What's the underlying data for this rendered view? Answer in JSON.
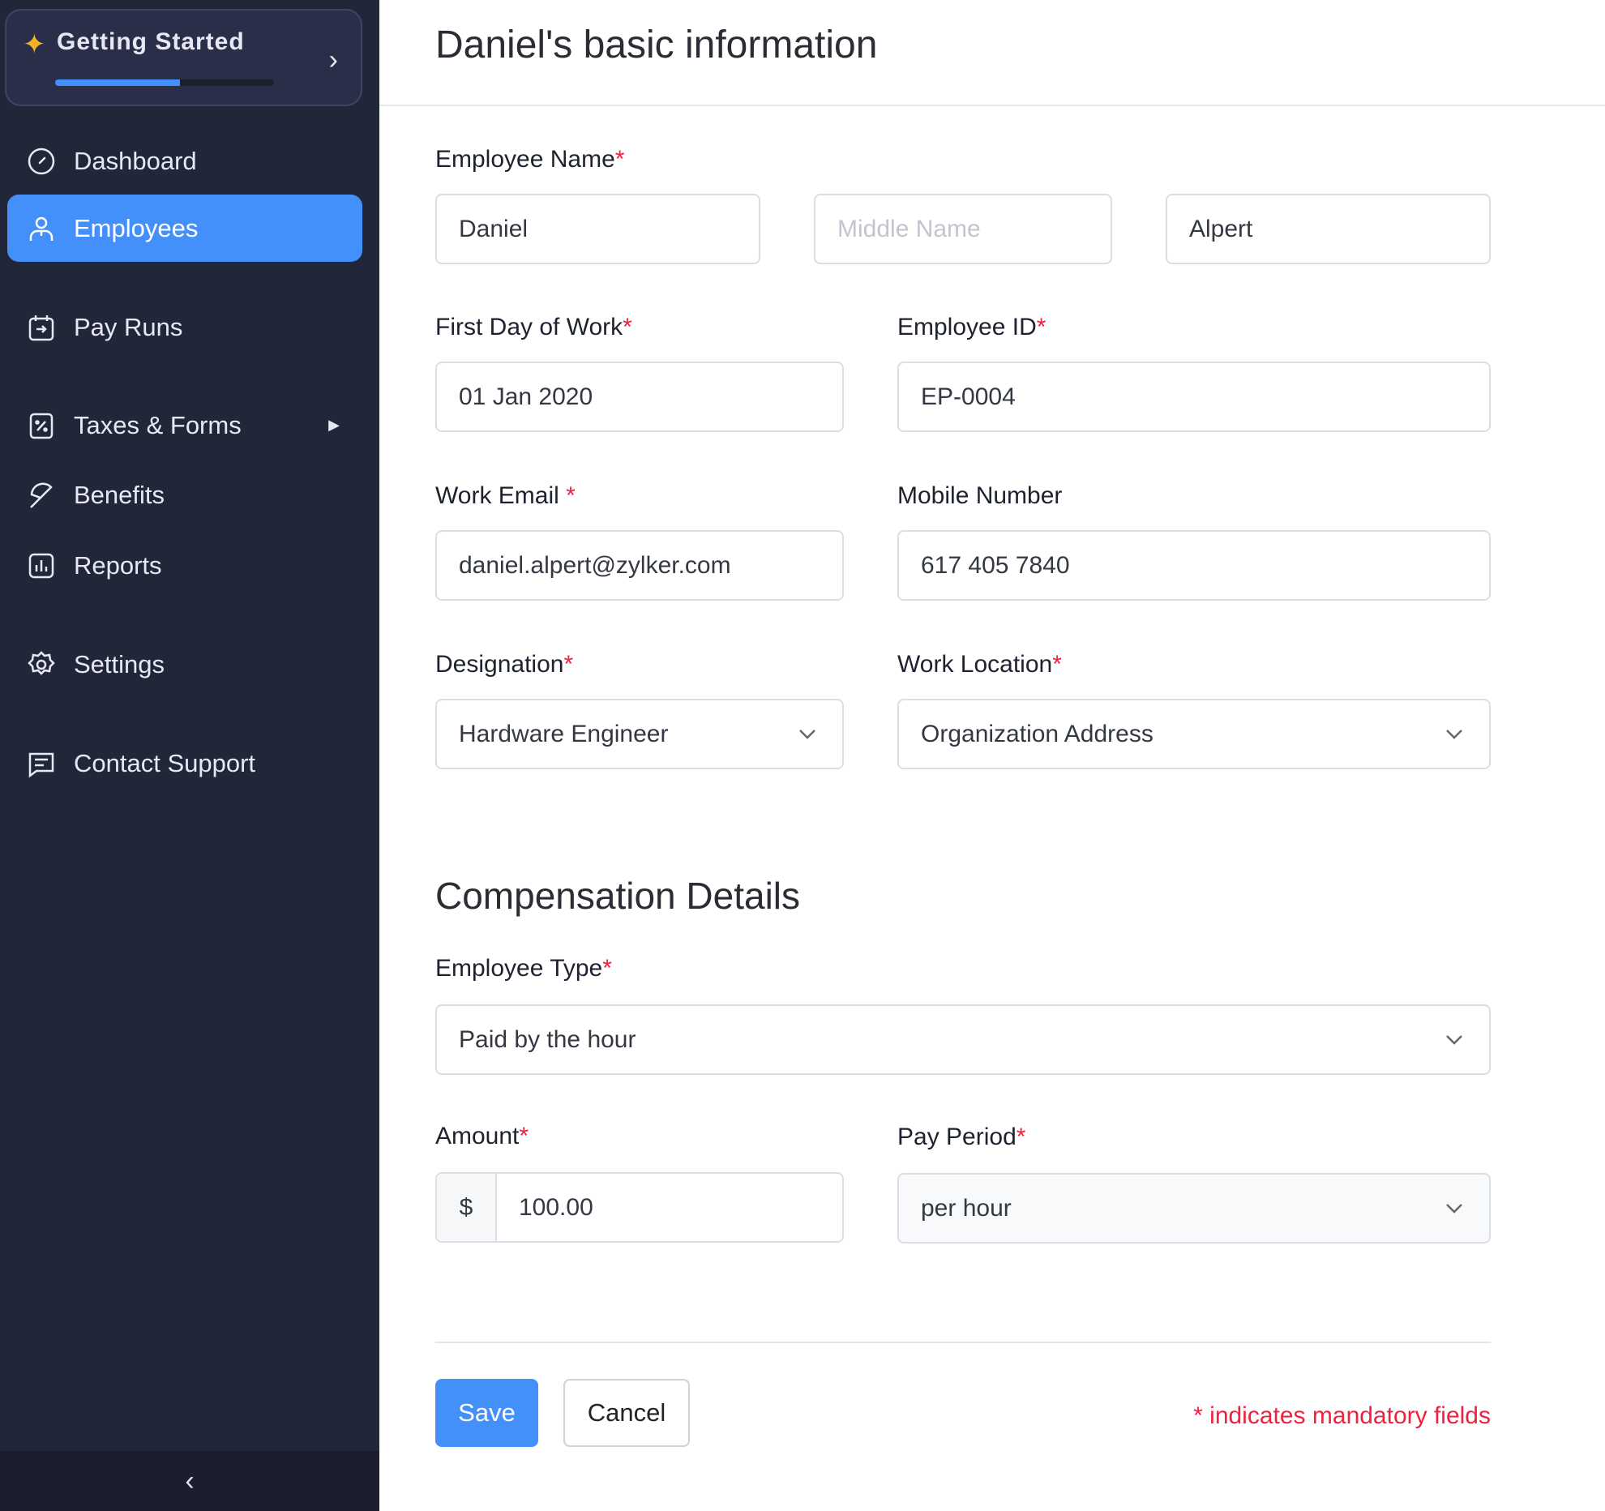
{
  "sidebar": {
    "getting_started": {
      "label": "Getting Started",
      "progress": 0.57
    },
    "items": [
      {
        "label": "Dashboard",
        "icon": "gauge-icon"
      },
      {
        "label": "Employees",
        "icon": "user-icon",
        "active": true
      },
      {
        "label": "Pay Runs",
        "icon": "calendar-icon"
      },
      {
        "label": "Taxes & Forms",
        "icon": "percent-doc-icon",
        "has_submenu": true
      },
      {
        "label": "Benefits",
        "icon": "umbrella-icon"
      },
      {
        "label": "Reports",
        "icon": "bar-chart-icon"
      },
      {
        "label": "Settings",
        "icon": "gear-icon"
      },
      {
        "label": "Contact Support",
        "icon": "chat-icon"
      }
    ],
    "collapse_icon": "chevron-left-icon"
  },
  "main": {
    "title": "Daniel's basic information",
    "required_mark": "*",
    "employee_name": {
      "label": "Employee Name",
      "first": "Daniel",
      "middle_placeholder": "Middle Name",
      "last": "Alpert"
    },
    "first_day": {
      "label": "First Day of Work",
      "value": "01 Jan 2020"
    },
    "employee_id": {
      "label": "Employee ID",
      "value": "EP-0004"
    },
    "work_email": {
      "label": "Work Email ",
      "value": "daniel.alpert@zylker.com"
    },
    "mobile": {
      "label": "Mobile Number",
      "value": "617 405 7840"
    },
    "designation": {
      "label": "Designation",
      "value": "Hardware Engineer"
    },
    "work_location": {
      "label": "Work Location",
      "value": "Organization Address"
    },
    "compensation_title": "Compensation Details",
    "employee_type": {
      "label": "Employee Type",
      "value": "Paid by the hour"
    },
    "amount": {
      "label": "Amount",
      "currency": "$",
      "value": "100.00"
    },
    "pay_period": {
      "label": "Pay Period",
      "value": "per hour"
    },
    "save_label": "Save",
    "cancel_label": "Cancel",
    "mandatory_note": "* indicates mandatory fields"
  },
  "colors": {
    "accent": "#4390fa",
    "sidebar": "#222639",
    "required": "#f0213f",
    "star": "#f6b12a"
  }
}
